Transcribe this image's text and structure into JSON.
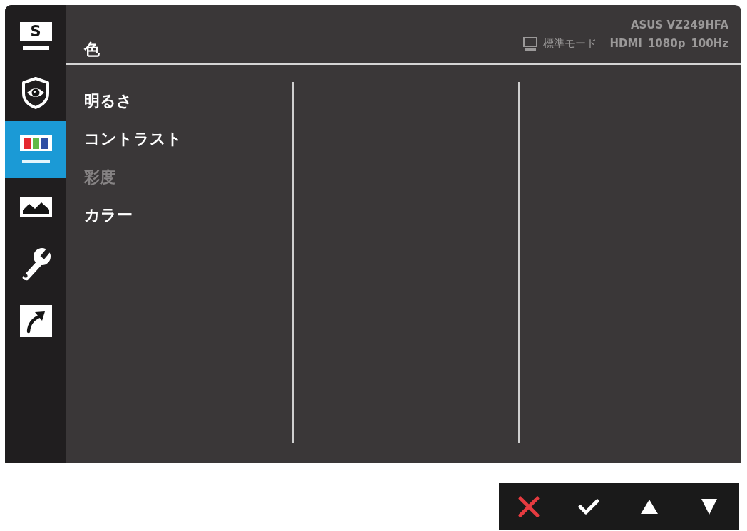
{
  "sidebar": {
    "items": [
      {
        "kind": "card",
        "letter": "S",
        "selected": false
      },
      {
        "kind": "shield",
        "selected": false
      },
      {
        "kind": "bars",
        "selected": true
      },
      {
        "kind": "landscape",
        "selected": false
      },
      {
        "kind": "wrench",
        "selected": false
      },
      {
        "kind": "arrow",
        "selected": false
      }
    ]
  },
  "header": {
    "title": "色",
    "model": "ASUS VZ249HFA",
    "status": {
      "mode": "標準モード",
      "input": "HDMI",
      "resolution": "1080p",
      "refresh_rate": "100Hz"
    }
  },
  "menu": {
    "items": [
      {
        "label": "明るさ",
        "disabled": false
      },
      {
        "label": "コントラスト",
        "disabled": false
      },
      {
        "label": "彩度",
        "disabled": true
      },
      {
        "label": "カラー",
        "disabled": false
      }
    ]
  },
  "keys": [
    {
      "kind": "close"
    },
    {
      "kind": "confirm"
    },
    {
      "kind": "up"
    },
    {
      "kind": "down"
    }
  ]
}
